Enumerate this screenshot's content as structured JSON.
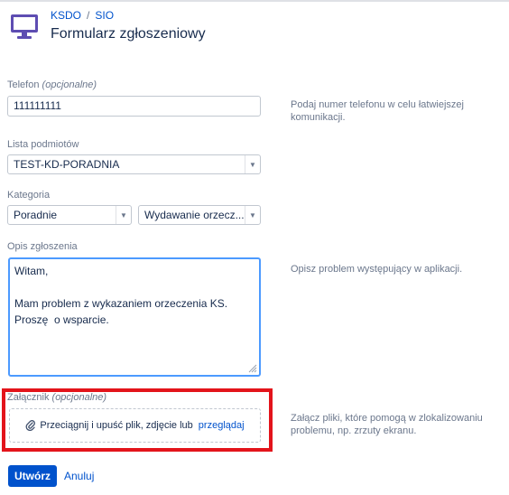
{
  "header": {
    "breadcrumb": [
      "KSDO",
      "SIO"
    ],
    "breadcrumb_sep": "/",
    "title": "Formularz zgłoszeniowy",
    "icon": "monitor-icon"
  },
  "phone": {
    "label": "Telefon",
    "optional": "(opcjonalne)",
    "value": "111111111",
    "help": "Podaj numer telefonu w celu łatwiejszej komunikacji."
  },
  "entities": {
    "label": "Lista podmiotów",
    "selected": "TEST-KD-PORADNIA"
  },
  "category": {
    "label": "Kategoria",
    "primary": "Poradnie",
    "secondary": "Wydawanie orzecz..."
  },
  "description": {
    "label": "Opis zgłoszenia",
    "lines": [
      "Witam,",
      "",
      "Mam problem z wykazaniem orzeczenia KS.",
      "Proszę  o wsparcie."
    ],
    "help": "Opisz problem występujący w aplikacji."
  },
  "attachment": {
    "label": "Załącznik",
    "optional": "(opcjonalne)",
    "drop_text": "Przeciągnij i upuść plik, zdjęcie lub",
    "browse": "przeglądaj",
    "help": "Załącz pliki, które pomogą w zlokalizowaniu problemu, np. zrzuty ekranu.",
    "highlight_color": "#e3141b"
  },
  "actions": {
    "submit": "Utwórz",
    "cancel": "Anuluj"
  },
  "colors": {
    "accent": "#0052cc",
    "focus": "#4c9aff"
  }
}
